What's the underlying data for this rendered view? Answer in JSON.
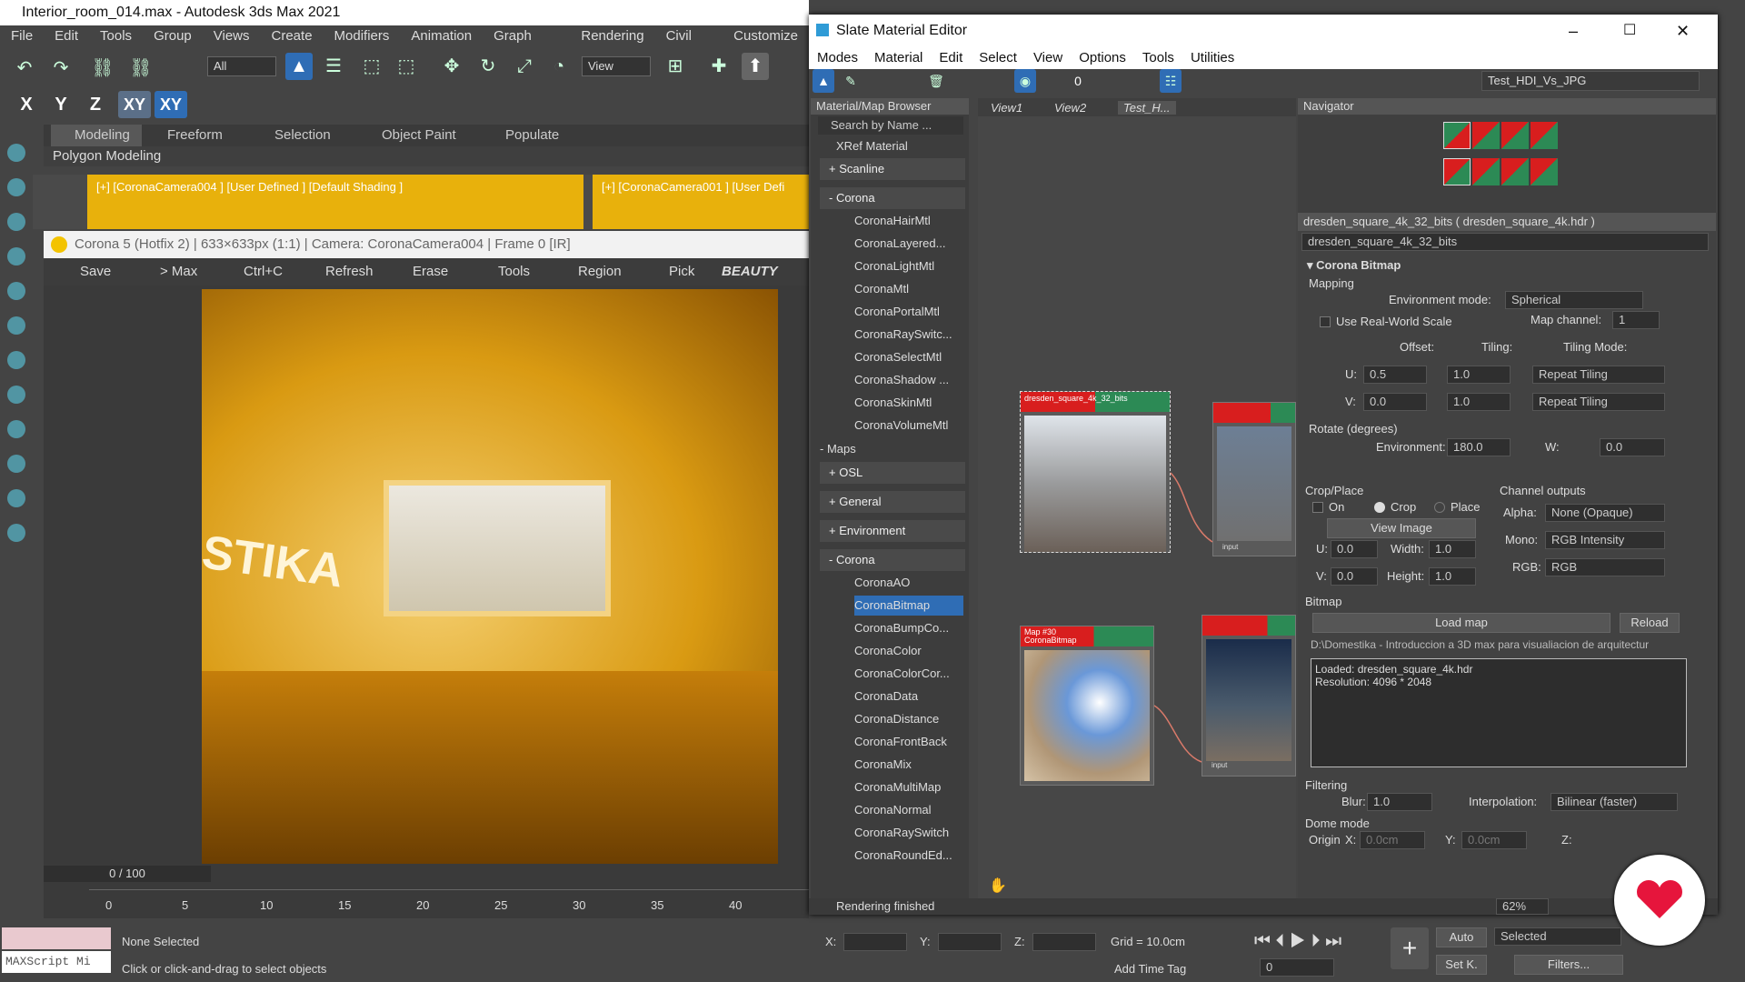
{
  "app": {
    "title": "Interior_room_014.max - Autodesk 3ds Max 2021"
  },
  "menu": [
    "File",
    "Edit",
    "Tools",
    "Group",
    "Views",
    "Create",
    "Modifiers",
    "Animation",
    "Graph Editors",
    "Rendering",
    "Civil View",
    "Customize"
  ],
  "toolbar": {
    "selection_filter": "All",
    "ref_coord": "View",
    "axis": [
      "X",
      "Y",
      "Z",
      "XY",
      "XY"
    ]
  },
  "ribbon": {
    "tabs": [
      "Modeling",
      "Freeform",
      "Selection",
      "Object Paint",
      "Populate"
    ],
    "sub": "Polygon Modeling"
  },
  "viewports": [
    "[+] [CoronaCamera004 ] [User Defined ] [Default Shading ]",
    "[+] [CoronaCamera001 ] [User Defi"
  ],
  "frame_buffer": {
    "title": "Corona 5 (Hotfix 2) | 633×633px (1:1) | Camera: CoronaCamera004 | Frame 0 [IR]",
    "tools": [
      "Save",
      "> Max",
      "Ctrl+C",
      "Refresh",
      "Erase",
      "Tools",
      "Region",
      "Pick",
      "BEAUTY"
    ],
    "sign": "STIKA"
  },
  "timeline": {
    "counter": "0 / 100",
    "ticks": [
      "0",
      "5",
      "10",
      "15",
      "20",
      "25",
      "30",
      "35",
      "40"
    ]
  },
  "status": {
    "selection": "None Selected",
    "prompt": "Click or click-and-drag to select objects",
    "maxscript": "MAXScript Mi",
    "x": "X:",
    "y": "Y:",
    "z": "Z:",
    "grid": "Grid = 10.0cm",
    "add_time_tag": "Add Time Tag",
    "auto": "Auto",
    "setk": "Set K.",
    "selected": "Selected",
    "filters": "Filters...",
    "frame": "0"
  },
  "sme": {
    "title": "Slate Material Editor",
    "menu": [
      "Modes",
      "Material",
      "Edit",
      "Select",
      "View",
      "Options",
      "Tools",
      "Utilities"
    ],
    "dropdown": "Test_HDI_Vs_JPG",
    "browser": {
      "title": "Material/Map Browser",
      "search": "Search by Name ...",
      "xref": "XRef Material",
      "scanline": "+ Scanline",
      "corona_head": "- Corona",
      "materials": [
        "CoronaHairMtl",
        "CoronaLayered...",
        "CoronaLightMtl",
        "CoronaMtl",
        "CoronaPortalMtl",
        "CoronaRaySwitc...",
        "CoronaSelectMtl",
        "CoronaShadow ...",
        "CoronaSkinMtl",
        "CoronaVolumeMtl"
      ],
      "maps_head": "- Maps",
      "osl": "+ OSL",
      "general": "+ General",
      "environment": "+ Environment",
      "corona_maps_head": "- Corona",
      "maps": [
        "CoronaAO",
        "CoronaBitmap",
        "CoronaBumpCo...",
        "CoronaColor",
        "CoronaColorCor...",
        "CoronaData",
        "CoronaDistance",
        "CoronaFrontBack",
        "CoronaMix",
        "CoronaMultiMap",
        "CoronaNormal",
        "CoronaRaySwitch",
        "CoronaRoundEd..."
      ]
    },
    "view_tabs": [
      "View1",
      "View2",
      "Test_H..."
    ],
    "nodes": {
      "n1": "dresden_square_4k_32_bits",
      "n2": "Map #30\nCoronaBitmap",
      "input": "input"
    },
    "navigator": "Navigator",
    "params_title": "dresden_square_4k_32_bits ( dresden_square_4k.hdr )",
    "params_name": "dresden_square_4k_32_bits",
    "rollout": "Corona Bitmap",
    "mapping": "Mapping",
    "env_mode_label": "Environment mode:",
    "env_mode": "Spherical",
    "use_rw": "Use Real-World Scale",
    "map_channel_label": "Map channel:",
    "map_channel": "1",
    "offset": "Offset:",
    "tiling": "Tiling:",
    "tiling_mode": "Tiling Mode:",
    "u": "U:",
    "u_off": "0.5",
    "u_til": "1.0",
    "u_mode": "Repeat Tiling",
    "v": "V:",
    "v_off": "0.0",
    "v_til": "1.0",
    "v_mode": "Repeat Tiling",
    "rotate": "Rotate (degrees)",
    "env_label": "Environment:",
    "env_rot": "180.0",
    "w_label": "W:",
    "w": "0.0",
    "crop_place": "Crop/Place",
    "on": "On",
    "crop": "Crop",
    "place": "Place",
    "view_image": "View Image",
    "cu": "0.0",
    "width_label": "Width:",
    "width": "1.0",
    "cv": "0.0",
    "height_label": "Height:",
    "height": "1.0",
    "channel_outputs": "Channel outputs",
    "alpha_label": "Alpha:",
    "alpha": "None (Opaque)",
    "mono_label": "Mono:",
    "mono": "RGB Intensity",
    "rgb_label": "RGB:",
    "rgb": "RGB",
    "bitmap": "Bitmap",
    "load_map": "Load map",
    "reload": "Reload",
    "path": "D:\\Domestika - Introduccion a 3D max para visualiacion de arquitectur",
    "loaded": "Loaded: dresden_square_4k.hdr",
    "resolution": "Resolution: 4096 * 2048",
    "filtering": "Filtering",
    "blur_label": "Blur:",
    "blur": "1.0",
    "interp_label": "Interpolation:",
    "interp": "Bilinear (faster)",
    "dome": "Dome mode",
    "origin": "Origin",
    "ox": "X:",
    "ox_v": "0.0cm",
    "oy": "Y:",
    "oy_v": "0.0cm",
    "oz": "Z:",
    "rendering": "Rendering finished",
    "zoom": "62%"
  },
  "colors": {
    "accent": "#2f6db5",
    "render": "#e8b10c",
    "red": "#d81e1e"
  }
}
